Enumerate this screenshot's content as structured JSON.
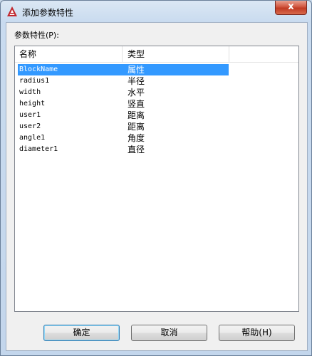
{
  "window": {
    "title": "添加参数特性"
  },
  "group_label": "参数特性(P):",
  "columns": [
    "名称",
    "类型"
  ],
  "rows": [
    {
      "name": "BlockName",
      "type": "属性",
      "selected": true
    },
    {
      "name": "radius1",
      "type": "半径",
      "selected": false
    },
    {
      "name": "width",
      "type": "水平",
      "selected": false
    },
    {
      "name": "height",
      "type": "竖直",
      "selected": false
    },
    {
      "name": "user1",
      "type": "距离",
      "selected": false
    },
    {
      "name": "user2",
      "type": "距离",
      "selected": false
    },
    {
      "name": "angle1",
      "type": "角度",
      "selected": false
    },
    {
      "name": "diameter1",
      "type": "直径",
      "selected": false
    }
  ],
  "buttons": {
    "ok": "确定",
    "cancel": "取消",
    "help": "帮助(H)"
  },
  "close_glyph": "x",
  "colors": {
    "selection": "#3399ff",
    "app_icon": "#c1272d"
  }
}
